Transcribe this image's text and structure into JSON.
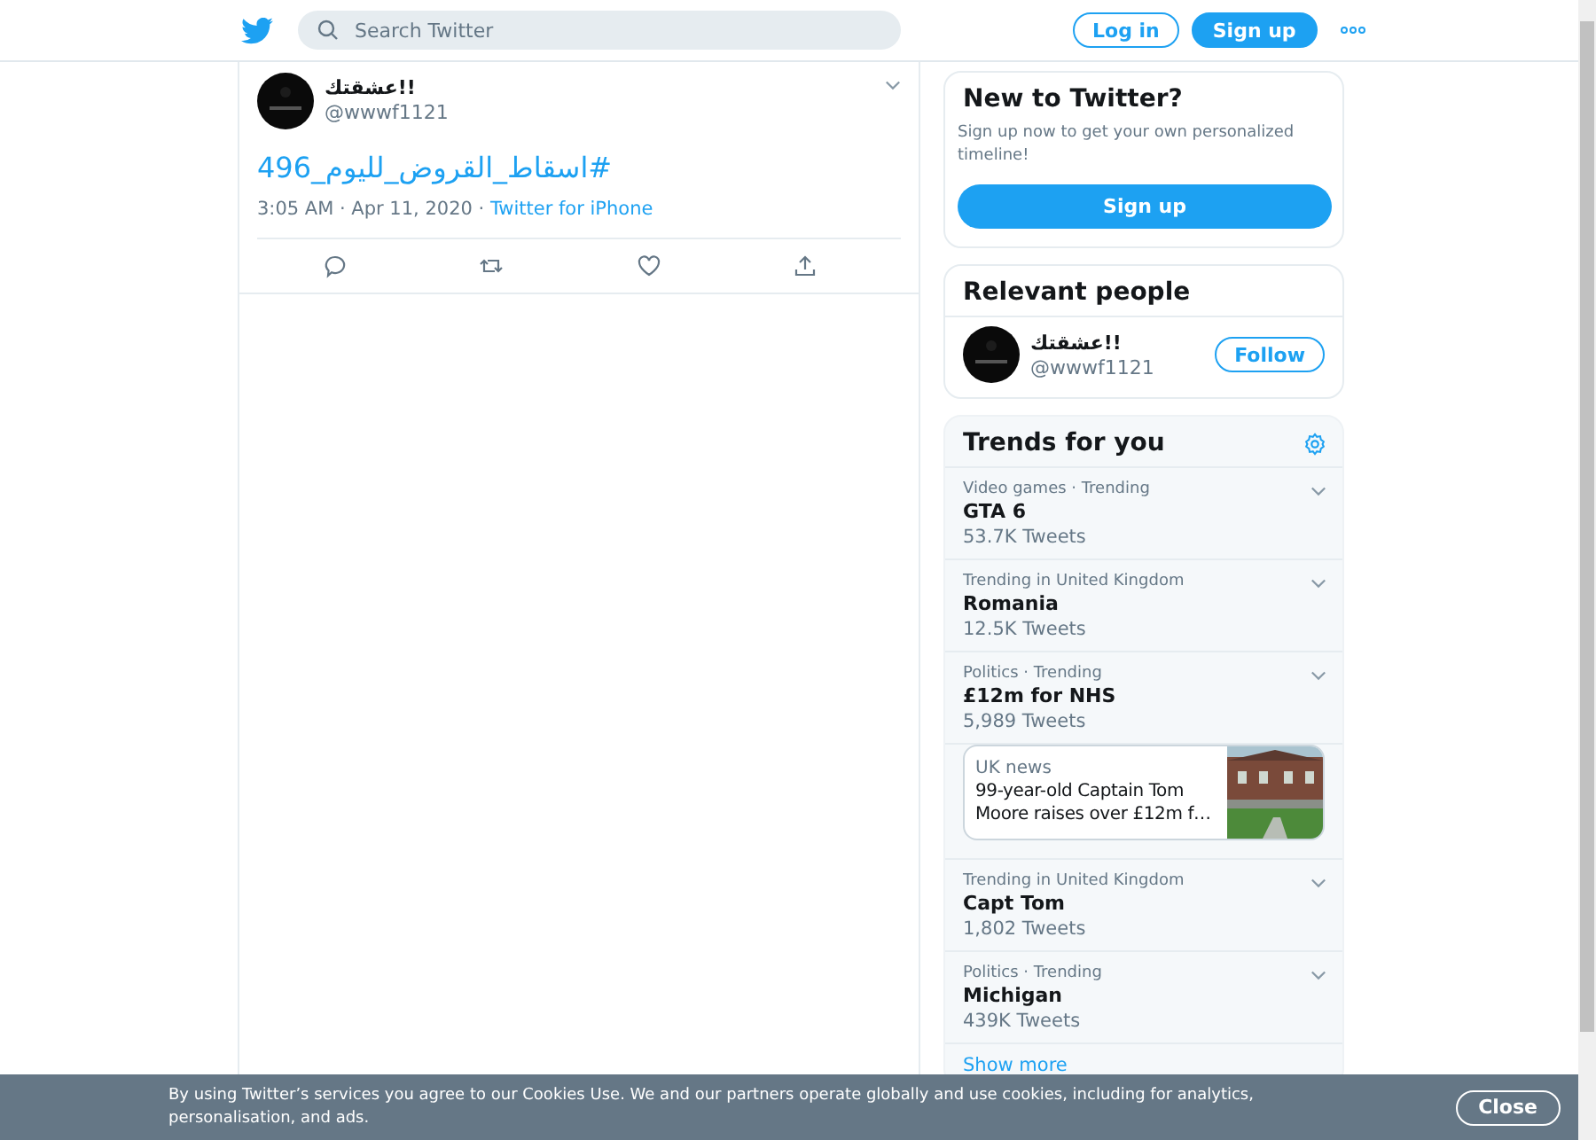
{
  "header": {
    "search": {
      "placeholder": "Search Twitter"
    },
    "buttons": [
      {
        "label": "Log in",
        "kind": "outline"
      },
      {
        "label": "Sign up",
        "kind": "filled"
      }
    ]
  },
  "tweet": {
    "name": "عشقتك!!",
    "handle": "@wwwf1121",
    "text": "#اسقاط_القروض_لليوم_496",
    "time": "3:05 AM · Apr 11, 2020 · ",
    "source": "Twitter for iPhone"
  },
  "signup_card": {
    "title": "New to Twitter?",
    "text": "Sign up now to get your own personalized timeline!",
    "button": "Sign up"
  },
  "relevant_people": {
    "title": "Relevant people",
    "people": [
      {
        "name": "عشقتك!!",
        "handle": "@wwwf1121",
        "button": "Follow"
      }
    ]
  },
  "trends": {
    "title": "Trends for you",
    "items": [
      {
        "kind": "trend",
        "context": "Video games · Trending",
        "name": "GTA 6",
        "count": "53.7K Tweets"
      },
      {
        "kind": "trend",
        "context": "Trending in United Kingdom",
        "name": "Romania",
        "count": "12.5K Tweets"
      },
      {
        "kind": "trend",
        "context": "Politics · Trending",
        "name": "£12m for NHS",
        "count": "5,989 Tweets"
      },
      {
        "kind": "news",
        "category": "UK news",
        "headline": "99-year-old Captain Tom Moore raises over £12m f…"
      },
      {
        "kind": "trend",
        "context": "Trending in United Kingdom",
        "name": "Capt Tom",
        "count": "1,802 Tweets"
      },
      {
        "kind": "trend",
        "context": "Politics · Trending",
        "name": "Michigan",
        "count": "439K Tweets"
      }
    ],
    "show_more": "Show more"
  },
  "cookie_banner": {
    "text": "By using Twitter’s services you agree to our ",
    "link": "Cookies Use",
    "text_after": ". We and our partners operate globally and use cookies, including for analytics, personalisation, and ads.",
    "button": "Close"
  }
}
